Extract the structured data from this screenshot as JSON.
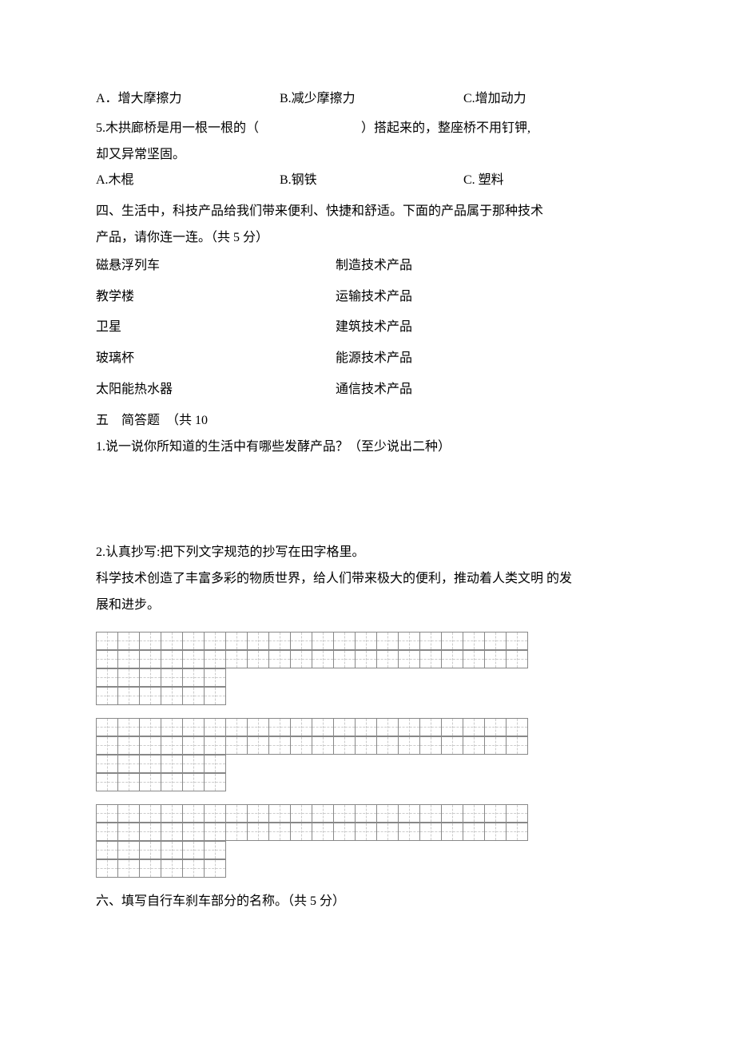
{
  "q4_options": {
    "a": "A．增大摩擦力",
    "b": "B.减少摩擦力",
    "c": "C.增加动力"
  },
  "q5": {
    "line1": "5.木拱廊桥是用一根一根的（　　　　　　　　）搭起来的，整座桥不用钉钾,",
    "line2": "却又异常坚固。",
    "a": "A.木棍",
    "b": "B.钢铁",
    "c": "C. 塑料"
  },
  "section4": {
    "title_l1": "四、生活中，科技产品给我们带来便利、快捷和舒适。下面的产品属于那种技术",
    "title_l2": "产品，请你连一连。（共 5 分）",
    "left": [
      "磁悬浮列车",
      "教学楼",
      "卫星",
      "玻璃杯",
      "太阳能热水器"
    ],
    "right": [
      "制造技术产品",
      "运输技术产品",
      "建筑技术产品",
      "能源技术产品",
      "通信技术产品"
    ]
  },
  "section5": {
    "title": "五　简答题　（共 10",
    "q1": "1.说一说你所知道的生活中有哪些发酵产品？（至少说出二种）",
    "q2_title": "2.认真抄写:把下列文字规范的抄写在田字格里。",
    "q2_text_l1": "科学技术创造了丰富多彩的物质世界，给人们带来极大的便利，推动着人类文明 的发",
    "q2_text_l2": "展和进步。"
  },
  "section6": {
    "title": "六、填写自行车刹车部分的名称。（共 5 分）"
  }
}
